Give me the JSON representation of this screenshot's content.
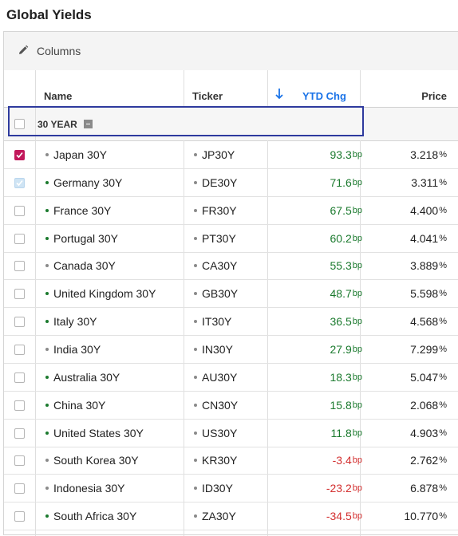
{
  "page_title": "Global Yields",
  "toolbar": {
    "columns_label": "Columns"
  },
  "columns": {
    "name": "Name",
    "ticker": "Ticker",
    "ytd": "YTD Chg",
    "price": "Price"
  },
  "group": {
    "label": "30 YEAR"
  },
  "colors": {
    "positive": "#1b7a2e",
    "negative": "#d32f2f",
    "accent": "#1a73e8",
    "checked": "#c2185b",
    "highlight": "#2e3a9e"
  },
  "rows": [
    {
      "name": "Japan 30Y",
      "ticker": "JP30Y",
      "ytd": "93.3",
      "ytd_unit": "bp",
      "price": "3.218",
      "price_unit": "%",
      "checked": true,
      "dot": "#8a8a8a"
    },
    {
      "name": "Germany 30Y",
      "ticker": "DE30Y",
      "ytd": "71.6",
      "ytd_unit": "bp",
      "price": "3.311",
      "price_unit": "%",
      "checked": "light",
      "dot": "#1b7a2e"
    },
    {
      "name": "France 30Y",
      "ticker": "FR30Y",
      "ytd": "67.5",
      "ytd_unit": "bp",
      "price": "4.400",
      "price_unit": "%",
      "checked": false,
      "dot": "#1b7a2e"
    },
    {
      "name": "Portugal 30Y",
      "ticker": "PT30Y",
      "ytd": "60.2",
      "ytd_unit": "bp",
      "price": "4.041",
      "price_unit": "%",
      "checked": false,
      "dot": "#1b7a2e"
    },
    {
      "name": "Canada 30Y",
      "ticker": "CA30Y",
      "ytd": "55.3",
      "ytd_unit": "bp",
      "price": "3.889",
      "price_unit": "%",
      "checked": false,
      "dot": "#8a8a8a"
    },
    {
      "name": "United Kingdom 30Y",
      "ticker": "GB30Y",
      "ytd": "48.7",
      "ytd_unit": "bp",
      "price": "5.598",
      "price_unit": "%",
      "checked": false,
      "dot": "#1b7a2e"
    },
    {
      "name": "Italy 30Y",
      "ticker": "IT30Y",
      "ytd": "36.5",
      "ytd_unit": "bp",
      "price": "4.568",
      "price_unit": "%",
      "checked": false,
      "dot": "#1b7a2e"
    },
    {
      "name": "India 30Y",
      "ticker": "IN30Y",
      "ytd": "27.9",
      "ytd_unit": "bp",
      "price": "7.299",
      "price_unit": "%",
      "checked": false,
      "dot": "#8a8a8a"
    },
    {
      "name": "Australia 30Y",
      "ticker": "AU30Y",
      "ytd": "18.3",
      "ytd_unit": "bp",
      "price": "5.047",
      "price_unit": "%",
      "checked": false,
      "dot": "#1b7a2e"
    },
    {
      "name": "China 30Y",
      "ticker": "CN30Y",
      "ytd": "15.8",
      "ytd_unit": "bp",
      "price": "2.068",
      "price_unit": "%",
      "checked": false,
      "dot": "#1b7a2e"
    },
    {
      "name": "United States 30Y",
      "ticker": "US30Y",
      "ytd": "11.8",
      "ytd_unit": "bp",
      "price": "4.903",
      "price_unit": "%",
      "checked": false,
      "dot": "#1b7a2e"
    },
    {
      "name": "South Korea 30Y",
      "ticker": "KR30Y",
      "ytd": "-3.4",
      "ytd_unit": "bp",
      "price": "2.762",
      "price_unit": "%",
      "checked": false,
      "dot": "#8a8a8a"
    },
    {
      "name": "Indonesia 30Y",
      "ticker": "ID30Y",
      "ytd": "-23.2",
      "ytd_unit": "bp",
      "price": "6.878",
      "price_unit": "%",
      "checked": false,
      "dot": "#8a8a8a"
    },
    {
      "name": "South Africa 30Y",
      "ticker": "ZA30Y",
      "ytd": "-34.5",
      "ytd_unit": "bp",
      "price": "10.770",
      "price_unit": "%",
      "checked": false,
      "dot": "#1b7a2e"
    }
  ]
}
